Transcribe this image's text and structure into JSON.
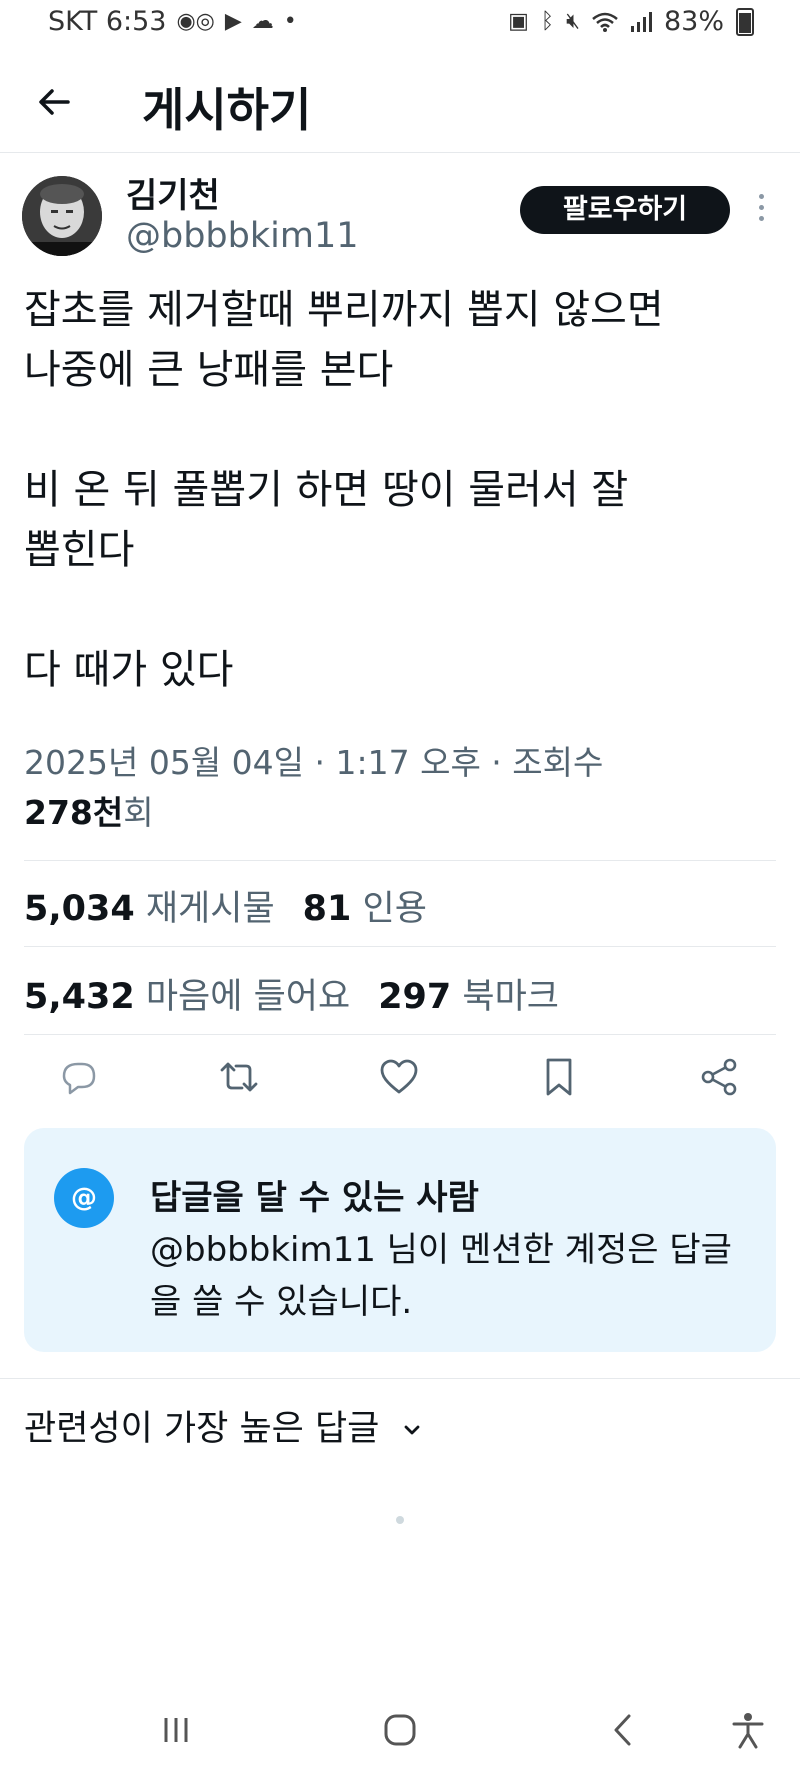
{
  "status_bar": {
    "carrier_time": "SKT 6:53",
    "battery_percent": "83%",
    "icons": [
      "voicemail-icon",
      "youtube-icon",
      "weather-icon",
      "dot-icon",
      "app-icon",
      "bluetooth-icon",
      "mute-icon",
      "wifi-icon",
      "signal-icon",
      "battery-icon"
    ]
  },
  "header": {
    "back_icon": "arrow-left-icon",
    "title": "게시하기"
  },
  "post": {
    "author_name": "김기천",
    "author_handle": "@bbbbkim11",
    "follow_label": "팔로우하기",
    "text": "잡초를 제거할때 뿌리까지 뽑지 않으면\n나중에 큰 낭패를 본다\n\n비 온 뒤 풀뽑기 하면 땅이 물러서 잘\n뽑힌다\n\n다 때가 있다",
    "timestamp": "2025년 05월 04일 · 1:17 오후 · 조회수",
    "views_count": "278천",
    "views_unit": "회"
  },
  "stats": {
    "reposts_count": "5,034",
    "reposts_label": "재게시물",
    "quotes_count": "81",
    "quotes_label": "인용",
    "likes_count": "5,432",
    "likes_label": "마음에 들어요",
    "bookmarks_count": "297",
    "bookmarks_label": "북마크"
  },
  "actions": [
    "reply-icon",
    "retweet-icon",
    "heart-icon",
    "bookmark-icon",
    "share-icon"
  ],
  "reply_restriction": {
    "icon_text": "@",
    "title": "답글을 달 수 있는 사람",
    "description": "@bbbbkim11 님이 멘션한 계정은 답글을 쓸 수 있습니다."
  },
  "replies_sort": {
    "label": "관련성이 가장 높은 답글"
  },
  "colors": {
    "accent": "#1d9bf0",
    "text_primary": "#0f1419",
    "text_secondary": "#536471",
    "card_background": "#e8f5fd"
  }
}
